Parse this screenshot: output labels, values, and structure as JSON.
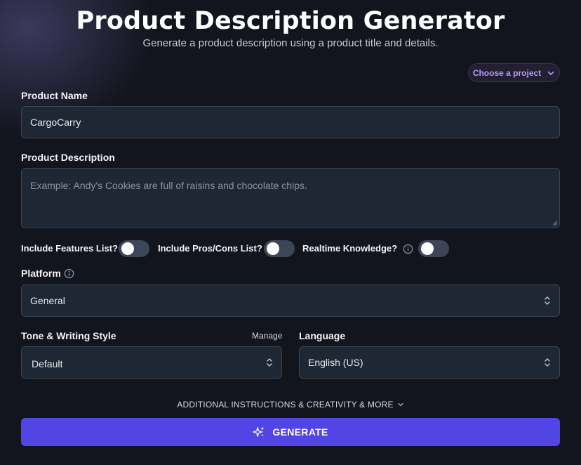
{
  "header": {
    "title": "Product Description Generator",
    "subtitle": "Generate a product description using a product title and details."
  },
  "project_selector": {
    "label": "Choose a project",
    "icon": "chevron-down-icon"
  },
  "form": {
    "product_name": {
      "label": "Product Name",
      "value": "CargoCarry"
    },
    "product_description": {
      "label": "Product Description",
      "value": "",
      "placeholder": "Example: Andy's Cookies are full of raisins and chocolate chips."
    },
    "toggles": [
      {
        "label": "Include Features List?",
        "enabled": false
      },
      {
        "label": "Include Pros/Cons List?",
        "enabled": false
      },
      {
        "label": "Realtime Knowledge?",
        "enabled": false,
        "info_icon": true
      }
    ],
    "platform": {
      "label": "Platform",
      "value": "General",
      "info_icon": true
    },
    "tone": {
      "label": "Tone & Writing Style",
      "manage_label": "Manage",
      "value": "Default"
    },
    "language": {
      "label": "Language",
      "value": "English (US)"
    }
  },
  "more_options": {
    "label": "ADDITIONAL INSTRUCTIONS & CREATIVITY & MORE"
  },
  "generate": {
    "label": "GENERATE",
    "icon": "sparkles-icon"
  },
  "colors": {
    "background": "#12151d",
    "field_bg": "#1e2733",
    "accent": "#5146e5",
    "project_text": "#b79cf0"
  }
}
